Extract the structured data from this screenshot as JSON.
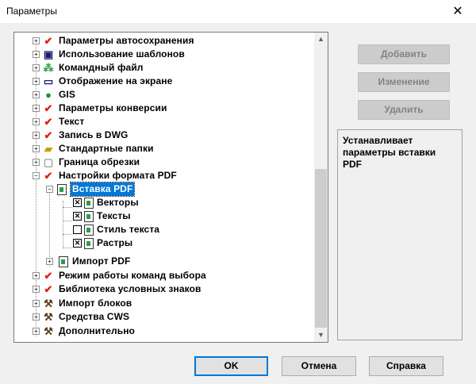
{
  "window": {
    "title": "Параметры",
    "close_glyph": "✕"
  },
  "tree": {
    "items": [
      {
        "label": "Параметры автосохранения",
        "icon": "check-icon"
      },
      {
        "label": "Использование шаблонов",
        "icon": "floppy-icon"
      },
      {
        "label": "Командный файл",
        "icon": "network-icon"
      },
      {
        "label": "Отображение на экране",
        "icon": "monitor-icon"
      },
      {
        "label": "GIS",
        "icon": "globe-icon"
      },
      {
        "label": "Параметры конверсии",
        "icon": "check-icon"
      },
      {
        "label": "Текст",
        "icon": "check-icon"
      },
      {
        "label": "Запись в DWG",
        "icon": "check-icon"
      },
      {
        "label": "Стандартные папки",
        "icon": "folder-icon"
      },
      {
        "label": "Граница обрезки",
        "icon": "frame-icon"
      },
      {
        "label": "Настройки формата PDF",
        "icon": "check-icon"
      },
      {
        "label": "Вставка PDF",
        "icon": "pdf-icon",
        "selected": true
      },
      {
        "label": "Векторы",
        "checked": true
      },
      {
        "label": "Тексты",
        "checked": true
      },
      {
        "label": "Стиль текста",
        "checked": false
      },
      {
        "label": "Растры",
        "checked": true
      },
      {
        "label": "Импорт PDF",
        "icon": "pdf-icon"
      },
      {
        "label": "Режим работы команд выбора",
        "icon": "check-icon"
      },
      {
        "label": "Библиотека условных знаков",
        "icon": "check-icon"
      },
      {
        "label": "Импорт блоков",
        "icon": "hammer-icon"
      },
      {
        "label": "Средства CWS",
        "icon": "hammer-icon"
      },
      {
        "label": "Дополнительно",
        "icon": "hammer-icon"
      }
    ]
  },
  "side_buttons": {
    "add": "Добавить",
    "edit": "Изменение",
    "delete": "Удалить"
  },
  "description": "Устанавливает параметры вставки PDF",
  "footer": {
    "ok": "OK",
    "cancel": "Отмена",
    "help": "Справка"
  },
  "colors": {
    "selection": "#0078d7",
    "check": "#e0201b"
  }
}
